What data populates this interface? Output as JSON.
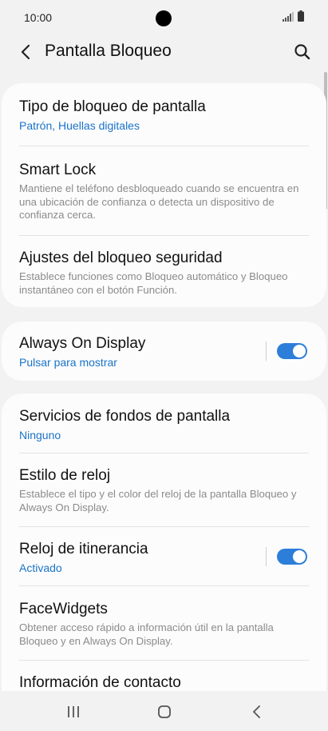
{
  "status_bar": {
    "time": "10:00"
  },
  "header": {
    "title": "Pantalla Bloqueo"
  },
  "cards": {
    "lock": {
      "screen_lock_type": {
        "title": "Tipo de bloqueo de pantalla",
        "value": "Patrón, Huellas digitales"
      },
      "smart_lock": {
        "title": "Smart Lock",
        "description": "Mantiene el teléfono desbloqueado cuando se encuentra en una ubicación de confianza o detecta un dispositivo de confianza cerca."
      },
      "secure_lock_settings": {
        "title": "Ajustes del bloqueo seguridad",
        "description": "Establece funciones como Bloqueo automático y Bloqueo instantáneo con el botón Función."
      }
    },
    "aod": {
      "always_on_display": {
        "title": "Always On Display",
        "value": "Pulsar para mostrar",
        "toggle_on": true
      }
    },
    "more": {
      "wallpaper_services": {
        "title": "Servicios de fondos de pantalla",
        "value": "Ninguno"
      },
      "clock_style": {
        "title": "Estilo de reloj",
        "description": "Establece el tipo y el color del reloj de la pantalla Bloqueo y Always On Display."
      },
      "roaming_clock": {
        "title": "Reloj de itinerancia",
        "value": "Activado",
        "toggle_on": true
      },
      "facewidgets": {
        "title": "FaceWidgets",
        "description": "Obtener acceso rápido a información útil en la pantalla Bloqueo y en Always On Display."
      },
      "contact_info": {
        "title": "Información de contacto"
      }
    }
  },
  "colors": {
    "accent": "#1a73c9",
    "toggle": "#2c7ed9",
    "background": "#f2f2f2",
    "card": "#fcfcfc"
  },
  "icons": {
    "back": "chevron-left-icon",
    "search": "search-icon",
    "recents": "recents-icon",
    "home": "home-icon",
    "nav_back": "nav-back-icon"
  }
}
